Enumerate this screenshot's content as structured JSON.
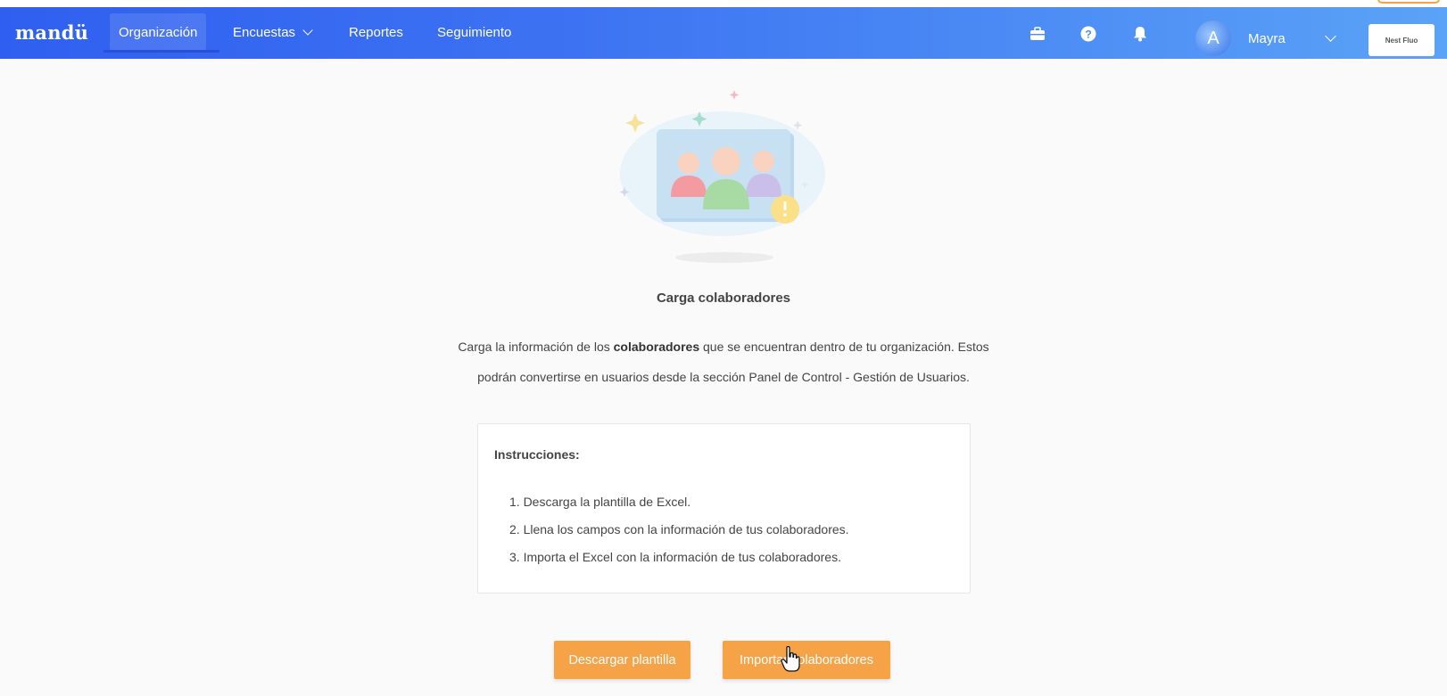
{
  "app": {
    "logo": "mandü",
    "brand_color": "#3a6df0",
    "accent_color": "#f6a347"
  },
  "nav": {
    "items": [
      {
        "label": "Organización",
        "active": true
      },
      {
        "label": "Encuestas",
        "has_dropdown": true
      },
      {
        "label": "Reportes"
      },
      {
        "label": "Seguimiento"
      }
    ],
    "icons": [
      "briefcase-icon",
      "help-icon",
      "bell-icon"
    ],
    "user": {
      "avatar_letter": "A",
      "name": "Mayra"
    },
    "company_label": "Nest Fluo"
  },
  "main": {
    "title": "Carga colaboradores",
    "description_part1": "Carga la información de los ",
    "description_bold": "colaboradores",
    "description_part2": " que se encuentran dentro de tu organización. Estos",
    "description_line2": "podrán convertirse en usuarios desde la sección Panel de Control - Gestión de Usuarios.",
    "instructions": {
      "title": "Instrucciones:",
      "steps": [
        "1. Descarga la plantilla de Excel.",
        "2. Llena los campos con la información de tus colaboradores.",
        "3. Importa el Excel con la información de tus colaboradores."
      ]
    },
    "buttons": {
      "download": "Descargar plantilla",
      "import": "Importar colaboradores"
    }
  }
}
